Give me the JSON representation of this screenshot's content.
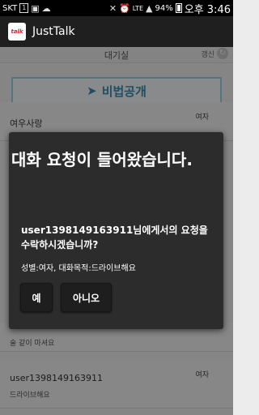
{
  "status_bar": {
    "carrier": "SKT",
    "box_number": "1",
    "battery": "94%",
    "time": "오후 3:46",
    "network": "LTE"
  },
  "app": {
    "title": "JustTalk",
    "logo_text": "talk"
  },
  "room": {
    "name": "대기실",
    "refresh_label": "갱신"
  },
  "banner": {
    "text": "비법공개"
  },
  "list": {
    "items": [
      {
        "name": "여우사랑",
        "gender": "여자",
        "subtitle": ""
      },
      {
        "name": "",
        "gender": "",
        "subtitle": "술 같이 마셔요"
      },
      {
        "name": "user1398149163911",
        "gender": "여자",
        "subtitle": "드라이브해요"
      }
    ]
  },
  "dialog": {
    "title": "대화 요청이 들어왔습니다.",
    "message": "user1398149163911님에게서의 요청을 수락하시겠습니까?",
    "info": "성별:여자, 대화목적:드라이브해요",
    "yes_label": "예",
    "no_label": "아니오"
  }
}
